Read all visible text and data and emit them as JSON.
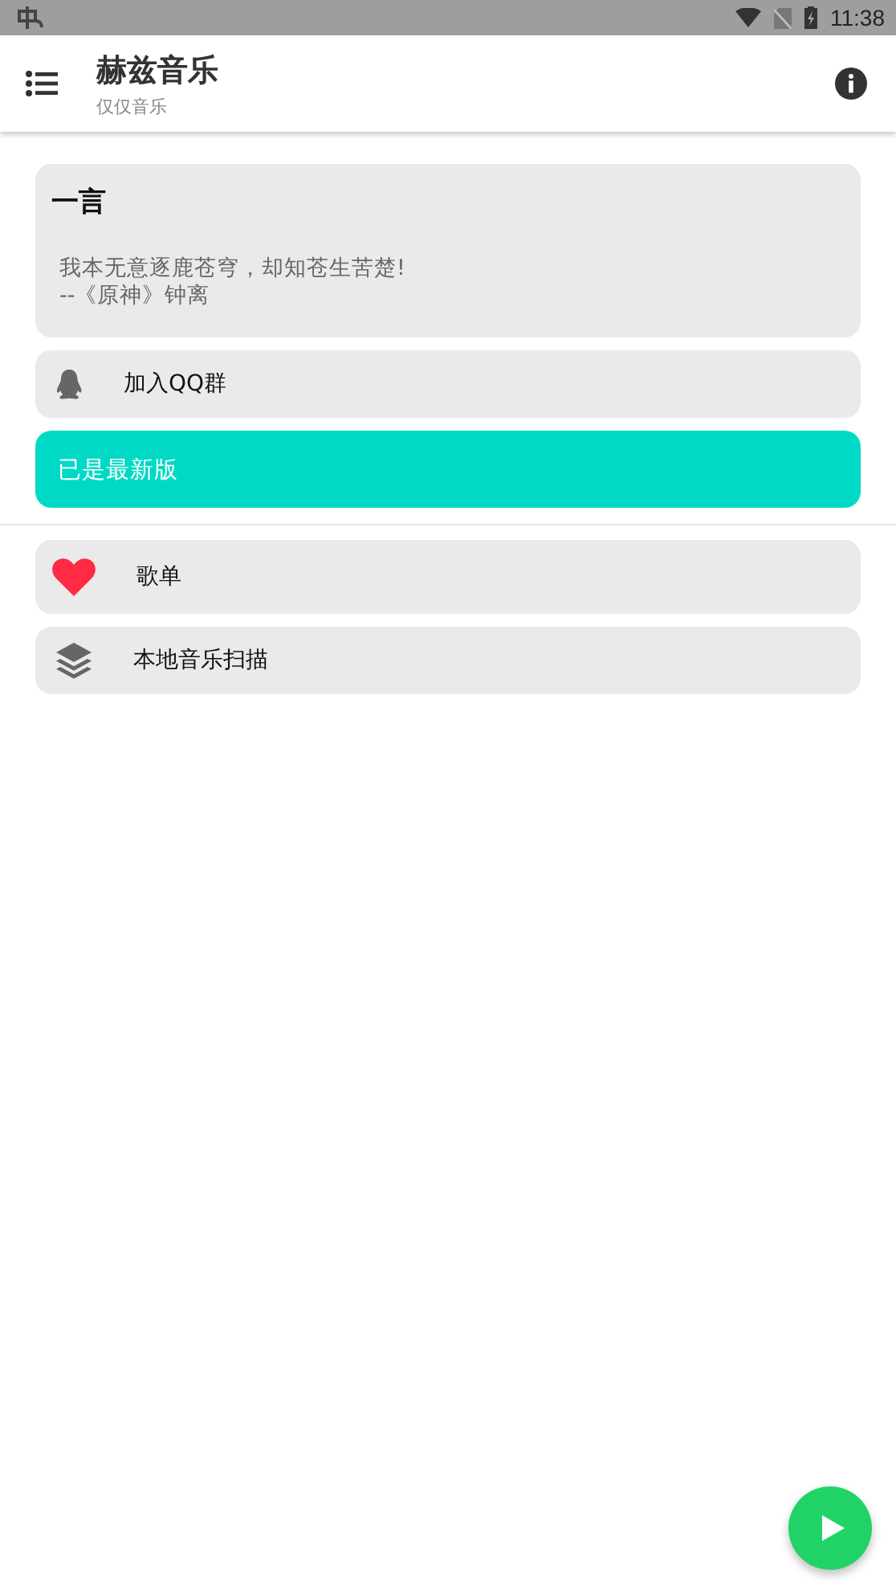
{
  "status_bar": {
    "time": "11:38"
  },
  "app_bar": {
    "title": "赫兹音乐",
    "subtitle": "仅仅音乐"
  },
  "quote_card": {
    "title": "一言",
    "text": "我本无意逐鹿苍穹，却知苍生苦楚!",
    "source": "--《原神》钟离"
  },
  "top_items": [
    {
      "kind": "qq",
      "label": "加入QQ群"
    }
  ],
  "update_button": {
    "label": "已是最新版"
  },
  "items": [
    {
      "kind": "heart",
      "label": "歌单"
    },
    {
      "kind": "layers",
      "label": "本地音乐扫描"
    }
  ]
}
